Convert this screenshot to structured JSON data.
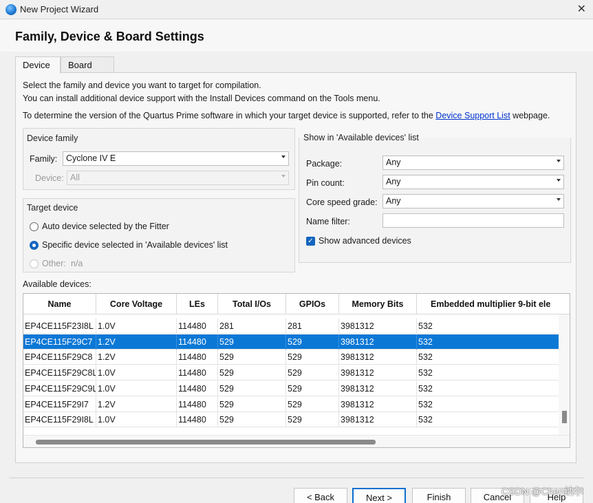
{
  "window": {
    "title": "New Project Wizard",
    "close_glyph": "✕"
  },
  "header": {
    "title": "Family, Device & Board Settings"
  },
  "tabs": [
    {
      "label": "Device",
      "active": true
    },
    {
      "label": "Board",
      "active": false
    }
  ],
  "description": {
    "line1": "Select the family and device you want to target for compilation.",
    "line2": "You can install additional device support with the Install Devices command on the Tools menu.",
    "line3_before": "To determine the version of the Quartus Prime software in which your target device is supported, refer to the ",
    "line3_link": "Device Support List",
    "line3_after": " webpage."
  },
  "device_family": {
    "title": "Device family",
    "family_label": "Family:",
    "family_value": "Cyclone IV E",
    "device_label": "Device:",
    "device_value": "All"
  },
  "target_device": {
    "title": "Target device",
    "auto_label": "Auto device selected by the Fitter",
    "specific_label": "Specific device selected in 'Available devices' list",
    "other_label": "Other:",
    "other_value": "n/a",
    "selected": "specific"
  },
  "show_in_list": {
    "title": "Show in 'Available devices' list",
    "package_label": "Package:",
    "package_value": "Any",
    "pin_count_label": "Pin count:",
    "pin_count_value": "Any",
    "speed_label": "Core speed grade:",
    "speed_value": "Any",
    "name_filter_label": "Name filter:",
    "name_filter_value": "",
    "show_advanced_label": "Show advanced devices",
    "show_advanced_checked": true
  },
  "available_devices": {
    "label": "Available devices:",
    "columns": [
      "Name",
      "Core Voltage",
      "LEs",
      "Total I/Os",
      "GPIOs",
      "Memory Bits",
      "Embedded multiplier 9-bit ele"
    ],
    "rows": [
      [
        "EP4CE115F23I8L",
        "1.0V",
        "114480",
        "281",
        "281",
        "3981312",
        "532"
      ],
      [
        "EP4CE115F29C7",
        "1.2V",
        "114480",
        "529",
        "529",
        "3981312",
        "532"
      ],
      [
        "EP4CE115F29C8",
        "1.2V",
        "114480",
        "529",
        "529",
        "3981312",
        "532"
      ],
      [
        "EP4CE115F29C8L",
        "1.0V",
        "114480",
        "529",
        "529",
        "3981312",
        "532"
      ],
      [
        "EP4CE115F29C9L",
        "1.0V",
        "114480",
        "529",
        "529",
        "3981312",
        "532"
      ],
      [
        "EP4CE115F29I7",
        "1.2V",
        "114480",
        "529",
        "529",
        "3981312",
        "532"
      ],
      [
        "EP4CE115F29I8L",
        "1.0V",
        "114480",
        "529",
        "529",
        "3981312",
        "532"
      ]
    ],
    "selected_row": 1
  },
  "buttons": {
    "back": "< Back",
    "next": "Next >",
    "finish": "Finish",
    "cancel": "Cancel",
    "help": "Help"
  },
  "watermark": "CSDN @Chen纳尔",
  "colors": {
    "selection": "#0b78d6",
    "accent": "#1565c0",
    "link": "#0033cc"
  }
}
